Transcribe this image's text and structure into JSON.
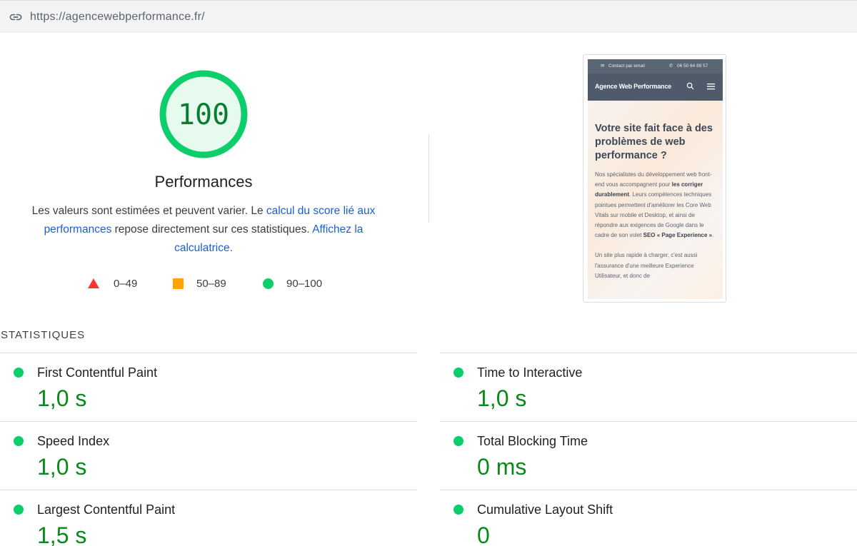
{
  "url_bar": {
    "url": "https://agencewebperformance.fr/"
  },
  "gauge": {
    "score": "100",
    "title": "Performances",
    "color": "#0cce6b"
  },
  "description": {
    "text_1": "Les valeurs sont estimées et peuvent varier. Le ",
    "link_1": "calcul du score lié aux performances",
    "text_2": " repose directement sur ces statistiques. ",
    "link_2": "Affichez la calculatrice."
  },
  "legend": [
    {
      "range": "0–49",
      "shape": "triangle",
      "color": "#ff3333"
    },
    {
      "range": "50–89",
      "shape": "square",
      "color": "#ffa400"
    },
    {
      "range": "90–100",
      "shape": "circle",
      "color": "#0cce6b"
    }
  ],
  "thumbnail": {
    "topbar_email": "Contact par email",
    "topbar_phone": "06 50 64 89 57",
    "brand": "Agence Web Performance",
    "headline": "Votre site fait face à des problèmes de web performance ?",
    "para_1a": "Nos spécialistes du développement web front-end vous accompagnent pour ",
    "para_1b": "les corriger durablement",
    "para_1c": ". Leurs compétences techniques pointues permettent d'améliorer les Core Web Vitals sur mobile et Desktop, et ainsi de répondre aux exigences de Google dans le cadre de son volet ",
    "para_1d": "SEO « Page Experience »",
    "para_1e": ".",
    "para_2": "Un site plus rapide à charger, c'est aussi l'assurance d'une meilleure Experience Utilisateur, et donc de"
  },
  "stats": {
    "title": "STATISTIQUES",
    "metrics": [
      {
        "label": "First Contentful Paint",
        "value": "1,0 s",
        "status": "good"
      },
      {
        "label": "Time to Interactive",
        "value": "1,0 s",
        "status": "good"
      },
      {
        "label": "Speed Index",
        "value": "1,0 s",
        "status": "good"
      },
      {
        "label": "Total Blocking Time",
        "value": "0 ms",
        "status": "good"
      },
      {
        "label": "Largest Contentful Paint",
        "value": "1,5 s",
        "status": "good"
      },
      {
        "label": "Cumulative Layout Shift",
        "value": "0",
        "status": "good"
      }
    ]
  }
}
